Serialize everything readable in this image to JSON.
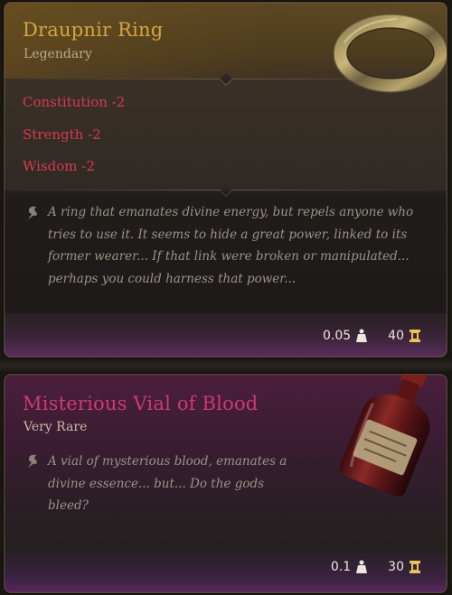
{
  "items": [
    {
      "name": "Draupnir Ring",
      "rarity": "Legendary",
      "stats": [
        "Constitution -2",
        "Strength -2",
        "Wisdom -2"
      ],
      "description": "A ring that emanates divine energy, but repels anyone who tries to use it. It seems to hide a great power, linked to its former wearer... If that link were broken or manipulated... perhaps you could harness that power...",
      "weight": "0.05",
      "value": "40",
      "title_color": "#d4a640",
      "art_icon": "gold-ring-icon"
    },
    {
      "name": "Misterious Vial of Blood",
      "rarity": "Very Rare",
      "description": "A vial of mysterious blood, emanates a divine essence... but... Do the gods bleed?",
      "weight": "0.1",
      "value": "30",
      "title_color": "#d1377a",
      "art_icon": "blood-vial-icon"
    }
  ],
  "colors": {
    "stat_penalty": "#d73a4f",
    "description_text": "#9c9287",
    "footer_text": "#ece6df"
  },
  "icons": {
    "weight": "weight-icon",
    "gold": "gold-coin-icon",
    "description_marker": "feather-icon"
  }
}
